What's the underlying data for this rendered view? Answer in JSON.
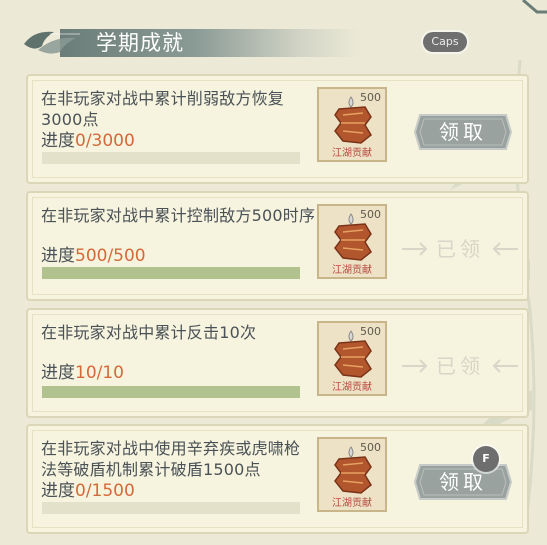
{
  "header": {
    "title": "学期成就",
    "caps_label": "Caps"
  },
  "achievements": [
    {
      "desc": "在非玩家对战中累计削弱敌方恢复3000点",
      "progress_label": "进度",
      "progress_value": "0/3000",
      "progress_fraction": 0.0,
      "reward_qty": "500",
      "reward_name": "江湖贡献",
      "reward_icon": "token-scroll-icon",
      "status": "claimable",
      "action_label": "领取"
    },
    {
      "desc": "在非玩家对战中累计控制敌方500时序",
      "progress_label": "进度",
      "progress_value": "500/500",
      "progress_fraction": 1.0,
      "reward_qty": "500",
      "reward_name": "江湖贡献",
      "reward_icon": "token-scroll-icon",
      "status": "claimed",
      "action_label": "已领"
    },
    {
      "desc": "在非玩家对战中累计反击10次",
      "progress_label": "进度",
      "progress_value": "10/10",
      "progress_fraction": 1.0,
      "reward_qty": "500",
      "reward_name": "江湖贡献",
      "reward_icon": "token-scroll-icon",
      "status": "claimed",
      "action_label": "已领"
    },
    {
      "desc": "在非玩家对战中使用辛弃疾或虎啸枪法等破盾机制累计破盾1500点",
      "progress_label": "进度",
      "progress_value": "0/1500",
      "progress_fraction": 0.0,
      "reward_qty": "500",
      "reward_name": "江湖贡献",
      "reward_icon": "token-scroll-icon",
      "status": "claimable",
      "action_label": "领取"
    }
  ],
  "hotkey": {
    "label": "F"
  },
  "colors": {
    "background": "#ecead7",
    "card": "#f6f3de",
    "progress_value": "#d36a3a",
    "bar_fill": "#b2c28e",
    "bar_track": "#e4e1cb",
    "button": "#9aa29f",
    "reward_label": "#b8493f"
  }
}
